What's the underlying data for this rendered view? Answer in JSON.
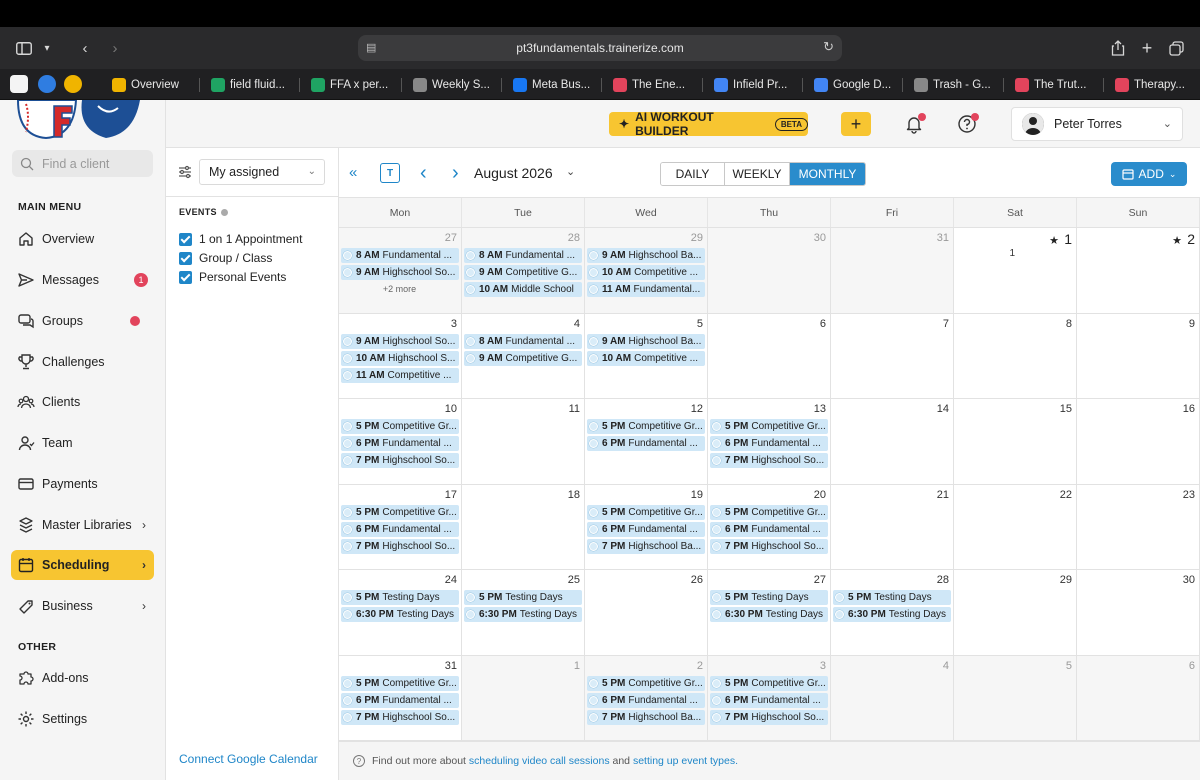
{
  "browser": {
    "url": "pt3fundamentals.trainerize.com",
    "tabs": [
      {
        "label": "Overview",
        "color": "#f0b400"
      },
      {
        "label": "field fluid...",
        "color": "#1fa463"
      },
      {
        "label": "FFA x per...",
        "color": "#1fa463"
      },
      {
        "label": "Weekly S...",
        "color": "#888888"
      },
      {
        "label": "Meta Bus...",
        "color": "#1877f2"
      },
      {
        "label": "The Ene...",
        "color": "#e2445c"
      },
      {
        "label": "Infield Pr...",
        "color": "#4285f4"
      },
      {
        "label": "Google D...",
        "color": "#4285f4"
      },
      {
        "label": "Trash - G...",
        "color": "#888888"
      },
      {
        "label": "The Trut...",
        "color": "#e2445c"
      },
      {
        "label": "Therapy...",
        "color": "#e2445c"
      }
    ]
  },
  "sidebar": {
    "search_placeholder": "Find a client",
    "main_menu_title": "MAIN MENU",
    "other_title": "OTHER",
    "items": [
      {
        "label": "Overview",
        "icon": "home-icon"
      },
      {
        "label": "Messages",
        "icon": "send-icon",
        "badge": "1"
      },
      {
        "label": "Groups",
        "icon": "chat-icon"
      },
      {
        "label": "Challenges",
        "icon": "trophy-icon"
      },
      {
        "label": "Clients",
        "icon": "clients-icon"
      },
      {
        "label": "Team",
        "icon": "team-icon"
      },
      {
        "label": "Payments",
        "icon": "payments-icon"
      },
      {
        "label": "Master Libraries",
        "icon": "libraries-icon"
      },
      {
        "label": "Scheduling",
        "icon": "calendar-icon"
      },
      {
        "label": "Business",
        "icon": "business-icon"
      }
    ],
    "other_items": [
      {
        "label": "Add-ons",
        "icon": "puzzle-icon"
      },
      {
        "label": "Settings",
        "icon": "gear-icon"
      }
    ]
  },
  "header": {
    "ai_button": "AI WORKOUT BUILDER",
    "beta": "BETA",
    "plus": "+",
    "user_name": "Peter Torres"
  },
  "filter": {
    "select_value": "My assigned",
    "events_title": "EVENTS",
    "checkboxes": [
      "1 on 1 Appointment",
      "Group / Class",
      "Personal Events"
    ],
    "gcal_link": "Connect Google Calendar"
  },
  "calendar": {
    "month_label": "August 2026",
    "today_label": "T",
    "views": [
      "DAILY",
      "WEEKLY",
      "MONTHLY"
    ],
    "active_view": "MONTHLY",
    "add_label": "ADD",
    "days_of_week": [
      "Mon",
      "Tue",
      "Wed",
      "Thu",
      "Fri",
      "Sat",
      "Sun"
    ],
    "weeks": [
      [
        {
          "day": "27",
          "other": true,
          "events": [
            {
              "time": "8 AM",
              "title": "Fundamental ..."
            },
            {
              "time": "9 AM",
              "title": "Highschool So..."
            }
          ],
          "more": "+2 more"
        },
        {
          "day": "28",
          "other": true,
          "events": [
            {
              "time": "8 AM",
              "title": "Fundamental ..."
            },
            {
              "time": "9 AM",
              "title": "Competitive G..."
            },
            {
              "time": "10 AM",
              "title": "Middle School"
            }
          ]
        },
        {
          "day": "29",
          "other": true,
          "events": [
            {
              "time": "9 AM",
              "title": "Highschool Ba..."
            },
            {
              "time": "10 AM",
              "title": "Competitive ..."
            },
            {
              "time": "11 AM",
              "title": "Fundamental..."
            }
          ]
        },
        {
          "day": "30",
          "other": true,
          "events": []
        },
        {
          "day": "31",
          "other": true,
          "events": []
        },
        {
          "day": "1",
          "other": false,
          "star": true,
          "count": "1",
          "events": []
        },
        {
          "day": "2",
          "other": false,
          "star": true,
          "events": []
        }
      ],
      [
        {
          "day": "3",
          "events": [
            {
              "time": "9 AM",
              "title": "Highschool So..."
            },
            {
              "time": "10 AM",
              "title": "Highschool S..."
            },
            {
              "time": "11 AM",
              "title": "Competitive ..."
            }
          ]
        },
        {
          "day": "4",
          "events": [
            {
              "time": "8 AM",
              "title": "Fundamental ..."
            },
            {
              "time": "9 AM",
              "title": "Competitive G..."
            }
          ]
        },
        {
          "day": "5",
          "events": [
            {
              "time": "9 AM",
              "title": "Highschool Ba..."
            },
            {
              "time": "10 AM",
              "title": "Competitive ..."
            }
          ]
        },
        {
          "day": "6",
          "events": []
        },
        {
          "day": "7",
          "events": []
        },
        {
          "day": "8",
          "events": []
        },
        {
          "day": "9",
          "events": []
        }
      ],
      [
        {
          "day": "10",
          "events": [
            {
              "time": "5 PM",
              "title": "Competitive Gr..."
            },
            {
              "time": "6 PM",
              "title": "Fundamental ..."
            },
            {
              "time": "7 PM",
              "title": "Highschool So..."
            }
          ]
        },
        {
          "day": "11",
          "events": []
        },
        {
          "day": "12",
          "events": [
            {
              "time": "5 PM",
              "title": "Competitive Gr..."
            },
            {
              "time": "6 PM",
              "title": "Fundamental ..."
            }
          ]
        },
        {
          "day": "13",
          "events": [
            {
              "time": "5 PM",
              "title": "Competitive Gr..."
            },
            {
              "time": "6 PM",
              "title": "Fundamental ..."
            },
            {
              "time": "7 PM",
              "title": "Highschool So..."
            }
          ]
        },
        {
          "day": "14",
          "events": []
        },
        {
          "day": "15",
          "events": []
        },
        {
          "day": "16",
          "events": []
        }
      ],
      [
        {
          "day": "17",
          "events": [
            {
              "time": "5 PM",
              "title": "Competitive Gr..."
            },
            {
              "time": "6 PM",
              "title": "Fundamental ..."
            },
            {
              "time": "7 PM",
              "title": "Highschool So..."
            }
          ]
        },
        {
          "day": "18",
          "events": []
        },
        {
          "day": "19",
          "events": [
            {
              "time": "5 PM",
              "title": "Competitive Gr..."
            },
            {
              "time": "6 PM",
              "title": "Fundamental ..."
            },
            {
              "time": "7 PM",
              "title": "Highschool Ba..."
            }
          ]
        },
        {
          "day": "20",
          "events": [
            {
              "time": "5 PM",
              "title": "Competitive Gr..."
            },
            {
              "time": "6 PM",
              "title": "Fundamental ..."
            },
            {
              "time": "7 PM",
              "title": "Highschool So..."
            }
          ]
        },
        {
          "day": "21",
          "events": []
        },
        {
          "day": "22",
          "events": []
        },
        {
          "day": "23",
          "events": []
        }
      ],
      [
        {
          "day": "24",
          "events": [
            {
              "time": "5 PM",
              "title": "Testing Days"
            },
            {
              "time": "6:30 PM",
              "title": "Testing Days"
            }
          ]
        },
        {
          "day": "25",
          "events": [
            {
              "time": "5 PM",
              "title": "Testing Days"
            },
            {
              "time": "6:30 PM",
              "title": "Testing Days"
            }
          ]
        },
        {
          "day": "26",
          "events": []
        },
        {
          "day": "27",
          "events": [
            {
              "time": "5 PM",
              "title": "Testing Days"
            },
            {
              "time": "6:30 PM",
              "title": "Testing Days"
            }
          ]
        },
        {
          "day": "28",
          "events": [
            {
              "time": "5 PM",
              "title": "Testing Days"
            },
            {
              "time": "6:30 PM",
              "title": "Testing Days"
            }
          ]
        },
        {
          "day": "29",
          "events": []
        },
        {
          "day": "30",
          "events": []
        }
      ],
      [
        {
          "day": "31",
          "events": [
            {
              "time": "5 PM",
              "title": "Competitive Gr..."
            },
            {
              "time": "6 PM",
              "title": "Fundamental ..."
            },
            {
              "time": "7 PM",
              "title": "Highschool So..."
            }
          ]
        },
        {
          "day": "1",
          "other": true,
          "events": []
        },
        {
          "day": "2",
          "other": true,
          "events": [
            {
              "time": "5 PM",
              "title": "Competitive Gr..."
            },
            {
              "time": "6 PM",
              "title": "Fundamental ..."
            },
            {
              "time": "7 PM",
              "title": "Highschool Ba..."
            }
          ]
        },
        {
          "day": "3",
          "other": true,
          "events": [
            {
              "time": "5 PM",
              "title": "Competitive Gr..."
            },
            {
              "time": "6 PM",
              "title": "Fundamental ..."
            },
            {
              "time": "7 PM",
              "title": "Highschool So..."
            }
          ]
        },
        {
          "day": "4",
          "other": true,
          "events": []
        },
        {
          "day": "5",
          "other": true,
          "events": []
        },
        {
          "day": "6",
          "other": true,
          "events": []
        }
      ]
    ]
  },
  "footer": {
    "prefix": "Find out more about",
    "link1": "scheduling video call sessions",
    "and": "and",
    "link2": "setting up event types."
  }
}
